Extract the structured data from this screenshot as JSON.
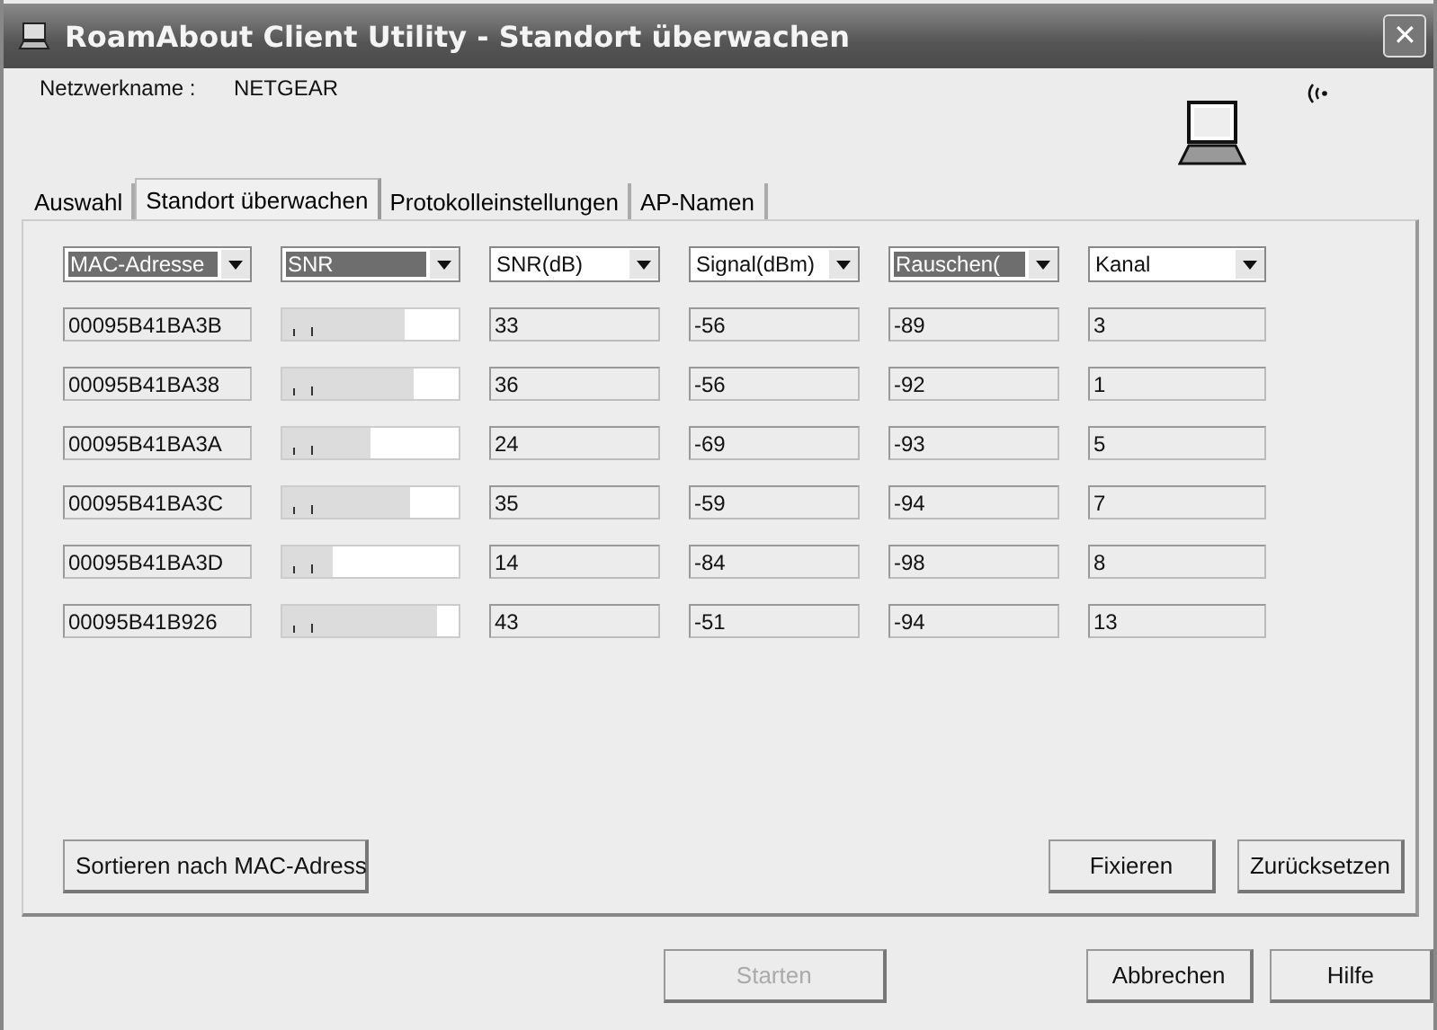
{
  "window": {
    "title": "RoamAbout Client Utility - Standort überwachen",
    "close": "✕"
  },
  "network": {
    "label": "Netzwerkname :",
    "value": "NETGEAR"
  },
  "tabs": [
    {
      "label": "Auswahl",
      "selected": false
    },
    {
      "label": "Standort überwachen",
      "selected": true
    },
    {
      "label": "Protokolleinstellungen",
      "selected": false
    },
    {
      "label": "AP-Namen",
      "selected": false
    }
  ],
  "columns": [
    {
      "label": "MAC-Adresse",
      "highlighted": true
    },
    {
      "label": "SNR",
      "highlighted": true
    },
    {
      "label": "SNR(dB)",
      "highlighted": false
    },
    {
      "label": "Signal(dBm)",
      "highlighted": false
    },
    {
      "label": "Rauschen(",
      "highlighted": true
    },
    {
      "label": "Kanal",
      "highlighted": false
    }
  ],
  "rows": [
    {
      "mac": "00095B41BA3B",
      "level": 0.69,
      "snr": "33",
      "signal": "-56",
      "noise": "-89",
      "channel": "3"
    },
    {
      "mac": "00095B41BA38",
      "level": 0.74,
      "snr": "36",
      "signal": "-56",
      "noise": "-92",
      "channel": "1"
    },
    {
      "mac": "00095B41BA3A",
      "level": 0.5,
      "snr": "24",
      "signal": "-69",
      "noise": "-93",
      "channel": "5"
    },
    {
      "mac": "00095B41BA3C",
      "level": 0.72,
      "snr": "35",
      "signal": "-59",
      "noise": "-94",
      "channel": "7"
    },
    {
      "mac": "00095B41BA3D",
      "level": 0.29,
      "snr": "14",
      "signal": "-84",
      "noise": "-98",
      "channel": "8"
    },
    {
      "mac": "00095B41B926",
      "level": 0.88,
      "snr": "43",
      "signal": "-51",
      "noise": "-94",
      "channel": "13"
    }
  ],
  "panel_buttons": [
    {
      "label": "Sortieren nach MAC-Adress",
      "disabled": false
    },
    {
      "label": "Fixieren",
      "disabled": false
    },
    {
      "label": "Zurücksetzen",
      "disabled": false
    }
  ],
  "buttons": [
    {
      "label": "Starten",
      "disabled": true
    },
    {
      "label": "Abbrechen",
      "disabled": false
    },
    {
      "label": "Hilfe",
      "disabled": false
    }
  ]
}
